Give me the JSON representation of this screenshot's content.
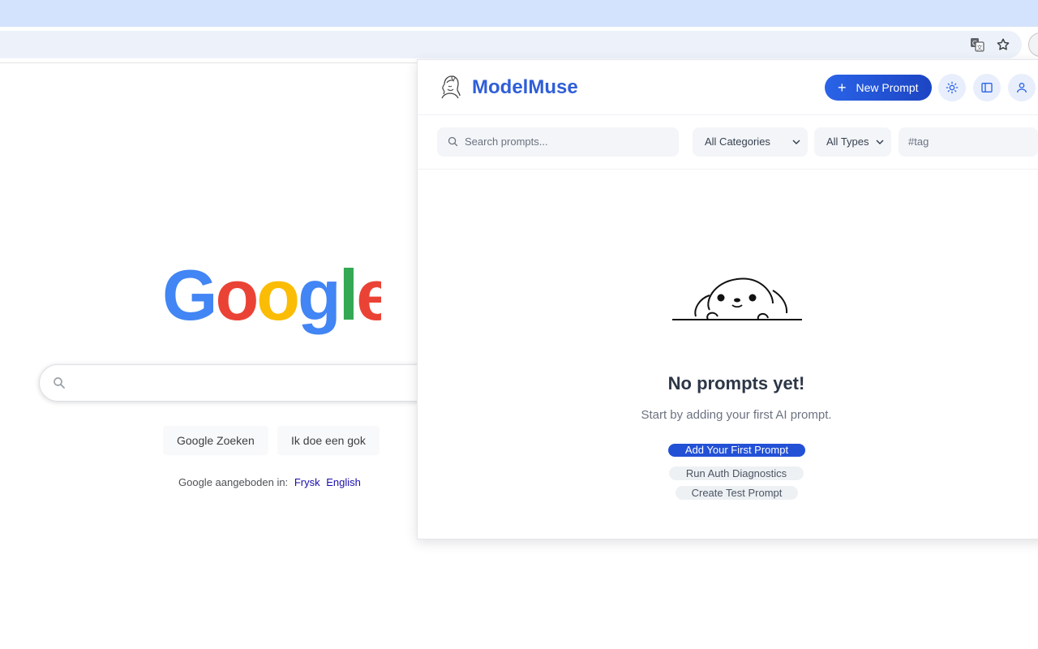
{
  "browser": {
    "icons": [
      "translate-icon",
      "star-icon",
      "avatar"
    ]
  },
  "google": {
    "logo_text": "Google",
    "search_button": "Google Zoeken",
    "lucky_button": "Ik doe een gok",
    "offered_in": "Google aangeboden in:",
    "languages": [
      "Frysk",
      "English"
    ],
    "colors": {
      "blue": "#4285F4",
      "red": "#EA4335",
      "yellow": "#FBBC05",
      "green": "#34A853"
    }
  },
  "panel": {
    "brand": "ModelMuse",
    "new_prompt": "New Prompt",
    "search_placeholder": "Search prompts...",
    "category_select": "All Categories",
    "type_select": "All Types",
    "tag_placeholder": "#tag",
    "empty_title": "No prompts yet!",
    "empty_subtitle": "Start by adding your first AI prompt.",
    "add_first": "Add Your First Prompt",
    "auth_diag": "Run Auth Diagnostics",
    "create_test": "Create Test Prompt",
    "accent": "#2a63e8"
  }
}
